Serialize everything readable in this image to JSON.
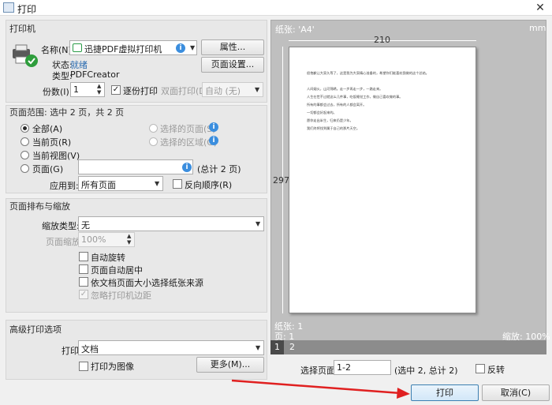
{
  "window": {
    "title": "打印"
  },
  "printer": {
    "section": "打印机",
    "name_label": "名称(N):",
    "name_value": "迅捷PDF虚拟打印机",
    "props_button": "属性...",
    "status_label": "状态:",
    "status_value": "就绪",
    "type_label": "类型:",
    "type_value": "PDFCreator",
    "page_setup_button": "页面设置...",
    "copies_label": "份数(I):",
    "copies_value": "1",
    "collate_label": "逐份打印",
    "duplex_label": "双面打印(D):",
    "duplex_value": "自动 (无)"
  },
  "range": {
    "section": "页面范围: 选中 2 页，共 2 页",
    "all": "全部(A)",
    "current": "当前页(R)",
    "current_view": "当前视图(V)",
    "pages": "页面(G)",
    "selected_pages": "选择的页面(S)",
    "selected_area": "选择的区域(G)",
    "total": "(总计 2 页)",
    "apply_label": "应用到:",
    "apply_value": "所有页面",
    "reverse": "反向顺序(R)"
  },
  "layout": {
    "section": "页面排布与缩放",
    "scale_type_label": "缩放类型:",
    "scale_type_value": "无",
    "zoom_label": "页面缩放:",
    "zoom_value": "100%",
    "auto_rotate": "自动旋转",
    "center": "页面自动居中",
    "by_size": "依文档页面大小选择纸张来源",
    "ignore_margins": "忽略打印机边距"
  },
  "advanced": {
    "section": "高级打印选项",
    "print_label": "打印",
    "print_value": "文档",
    "as_image": "打印为图像",
    "more_button": "更多(M)..."
  },
  "preview": {
    "paper": "纸张: 'A4'",
    "unit": "mm",
    "width": "210",
    "height": "297",
    "paper_count": "纸张: 1",
    "page_count": "页: 1",
    "zoom": "缩放: 100%",
    "tabs": [
      "1",
      "2"
    ],
    "doc_lines": [
      "很抱歉让大家久等了，这是我为大家精心准备的，希望你们能喜欢我做的这个总结。",
      "人间烟火，山河锦绣。走一步再走一步，一路走来。",
      "人生在世不过就这么几件事，吃饭睡觉工作，做自己喜欢做的事。",
      "所有的事都会过去，所有的人都会离开。",
      "一切都会好起来的。",
      "愿你走出半生，归来仍是少年。",
      "我们终将找到属于自己的那片天空。"
    ]
  },
  "bottom": {
    "select_label": "选择页面:",
    "select_value": "1-2",
    "select_info": "(选中 2, 总计 2)",
    "flip_label": "反转",
    "print_button": "打印",
    "cancel_button": "取消(C)"
  }
}
